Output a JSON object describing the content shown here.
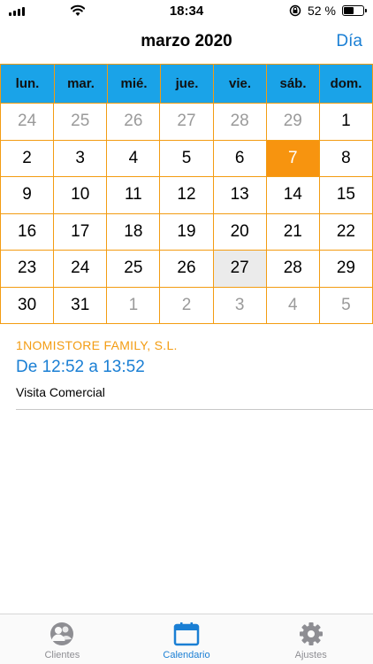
{
  "status_bar": {
    "time": "18:34",
    "battery_pct": "52 %",
    "battery_level": 0.52
  },
  "header": {
    "title": "marzo 2020",
    "day_button": "Día"
  },
  "calendar": {
    "weekdays": [
      "lun.",
      "mar.",
      "mié.",
      "jue.",
      "vie.",
      "sáb.",
      "dom."
    ],
    "days": [
      {
        "n": "24",
        "muted": true
      },
      {
        "n": "25",
        "muted": true
      },
      {
        "n": "26",
        "muted": true
      },
      {
        "n": "27",
        "muted": true
      },
      {
        "n": "28",
        "muted": true
      },
      {
        "n": "29",
        "muted": true
      },
      {
        "n": "1"
      },
      {
        "n": "2"
      },
      {
        "n": "3"
      },
      {
        "n": "4"
      },
      {
        "n": "5"
      },
      {
        "n": "6"
      },
      {
        "n": "7",
        "selected": true
      },
      {
        "n": "8"
      },
      {
        "n": "9"
      },
      {
        "n": "10"
      },
      {
        "n": "11"
      },
      {
        "n": "12"
      },
      {
        "n": "13"
      },
      {
        "n": "14"
      },
      {
        "n": "15"
      },
      {
        "n": "16"
      },
      {
        "n": "17"
      },
      {
        "n": "18"
      },
      {
        "n": "19"
      },
      {
        "n": "20"
      },
      {
        "n": "21"
      },
      {
        "n": "22"
      },
      {
        "n": "23"
      },
      {
        "n": "24"
      },
      {
        "n": "25"
      },
      {
        "n": "26"
      },
      {
        "n": "27",
        "today": true
      },
      {
        "n": "28"
      },
      {
        "n": "29"
      },
      {
        "n": "30"
      },
      {
        "n": "31"
      },
      {
        "n": "1",
        "muted": true
      },
      {
        "n": "2",
        "muted": true
      },
      {
        "n": "3",
        "muted": true
      },
      {
        "n": "4",
        "muted": true
      },
      {
        "n": "5",
        "muted": true
      }
    ]
  },
  "event": {
    "company": "1NOMISTORE FAMILY, S.L.",
    "time_range": "De 12:52 a 13:52",
    "description": "Visita Comercial"
  },
  "tab_bar": {
    "tabs": [
      {
        "label": "Clientes",
        "icon": "clients-icon",
        "active": false
      },
      {
        "label": "Calendario",
        "icon": "calendar-icon",
        "active": true
      },
      {
        "label": "Ajustes",
        "icon": "gear-icon",
        "active": false
      }
    ]
  },
  "colors": {
    "accent_blue": "#1a7fd4",
    "header_blue": "#1aa3e8",
    "orange": "#f39c12",
    "selected_orange": "#f7940f"
  }
}
